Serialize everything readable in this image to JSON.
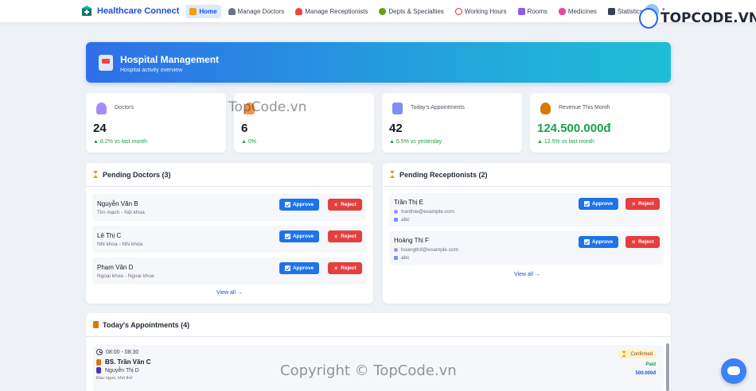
{
  "nav": {
    "brand": "Healthcare Connect",
    "items": [
      {
        "label": "Home",
        "active": true,
        "icon": "home-icon",
        "color": "#f59e0b"
      },
      {
        "label": "Manage Doctors",
        "active": false,
        "icon": "doctor-icon",
        "color": "#6b7280"
      },
      {
        "label": "Manage Receptionists",
        "active": false,
        "icon": "receptionist-icon",
        "color": "#ef4444"
      },
      {
        "label": "Depts & Specialties",
        "active": false,
        "icon": "department-icon",
        "color": "#65a30d"
      },
      {
        "label": "Working Hours",
        "active": false,
        "icon": "clock-icon",
        "color": "#dc2626"
      },
      {
        "label": "Rooms",
        "active": false,
        "icon": "room-icon",
        "color": "#8b5cf6"
      },
      {
        "label": "Medicines",
        "active": false,
        "icon": "pill-icon",
        "color": "#ec4899"
      },
      {
        "label": "Statistics",
        "active": false,
        "icon": "chart-icon",
        "color": "#374151"
      }
    ]
  },
  "banner": {
    "title": "Hospital Management",
    "subtitle": "Hospital activity overview"
  },
  "stats": [
    {
      "label": "Doctors",
      "value": "24",
      "trend": "8.2% vs last month",
      "icon": "doctor-icon",
      "color": "#a78bfa"
    },
    {
      "label": "",
      "value": "6",
      "trend": "0%",
      "icon": "receptionist-icon",
      "color": "#fb923c"
    },
    {
      "label": "Today's Appointments",
      "value": "42",
      "trend": "6.5% vs yesterday",
      "icon": "calendar-icon",
      "color": "#818cf8"
    },
    {
      "label": "Revenue This Month",
      "value": "124.500.000đ",
      "trend": "12.5% vs last month",
      "icon": "money-bag-icon",
      "color": "#d97706"
    }
  ],
  "pending_doctors": {
    "title": "Pending Doctors (3)",
    "approve_label": "Approve",
    "reject_label": "Reject",
    "view_all": "View all →",
    "rows": [
      {
        "name": "Nguyễn Văn B",
        "specialty": "Tim mạch - Nội khoa"
      },
      {
        "name": "Lê Thị C",
        "specialty": "Nhi khoa - Nhi khoa"
      },
      {
        "name": "Phạm Văn D",
        "specialty": "Ngoại khoa - Ngoại khoa"
      }
    ]
  },
  "pending_receptionists": {
    "title": "Pending Receptionists (2)",
    "approve_label": "Approve",
    "reject_label": "Reject",
    "view_all": "View all →",
    "rows": [
      {
        "name": "Trần Thị E",
        "email": "tranthie@example.com",
        "note": "abc"
      },
      {
        "name": "Hoàng Thị F",
        "email": "hoangthif@example.com",
        "note": "abc"
      }
    ]
  },
  "appointments": {
    "title": "Today's Appointments (4)",
    "rows": [
      {
        "time": "08:00 - 08:30",
        "doctor": "BS. Trần Văn C",
        "patient": "Nguyễn Thị D",
        "note": "Đau ngực, khó thở",
        "status": "Confirmed",
        "payment": "Paid",
        "amount": "500.000đ"
      }
    ]
  },
  "watermarks": {
    "top": "TopCode.vn",
    "logo_text": "TOPCODE.VN",
    "bottom": "Copyright © TopCode.vn"
  }
}
